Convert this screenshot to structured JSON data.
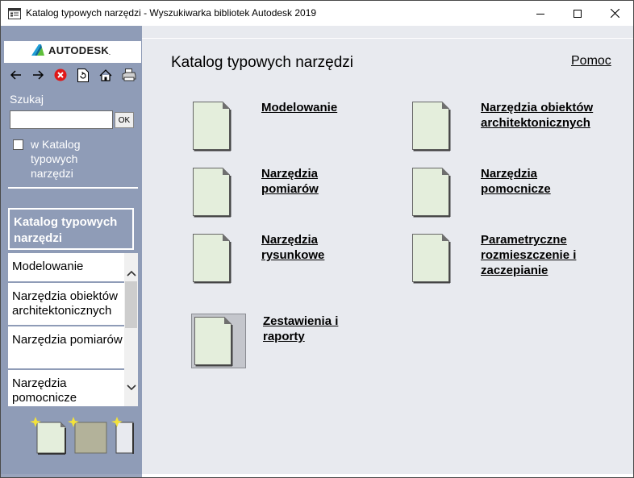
{
  "window": {
    "title": "Katalog typowych narzędzi - Wyszukiwarka bibliotek Autodesk 2019",
    "controls": {
      "minimize_icon": "minimize-icon",
      "maximize_icon": "maximize-icon",
      "close_icon": "close-icon"
    }
  },
  "sidebar": {
    "logo_text": "AUTODESK",
    "logo_tm": ".",
    "toolbar_icons": [
      "back-arrow-icon",
      "forward-arrow-icon",
      "stop-icon",
      "refresh-icon",
      "home-icon",
      "print-icon"
    ],
    "search": {
      "label": "Szukaj",
      "value": "",
      "ok_label": "OK"
    },
    "filter": {
      "checked": false,
      "label": "w Katalog typowych narzędzi"
    },
    "toc": {
      "header": "Katalog typowych narzędzi",
      "items": [
        "Modelowanie",
        "Narzędzia obiektów architektonicznych",
        "Narzędzia pomiarów",
        "Narzędzia pomocnicze"
      ]
    }
  },
  "main": {
    "title": "Katalog typowych narzędzi",
    "help_link": "Pomoc",
    "categories": [
      {
        "label_lines": [
          "Modelowanie"
        ]
      },
      {
        "label_lines": [
          "Narzędzia obiektów",
          "architektonicznych"
        ]
      },
      {
        "label_lines": [
          "Narzędzia",
          "pomiarów"
        ]
      },
      {
        "label_lines": [
          "Narzędzia",
          "pomocnicze"
        ]
      },
      {
        "label_lines": [
          "Narzędzia",
          "rysunkowe"
        ]
      },
      {
        "label_lines": [
          "Parametryczne",
          "rozmieszczenie i",
          "zaczepianie"
        ]
      },
      {
        "label_lines": [
          "Zestawienia i",
          "raporty"
        ]
      }
    ]
  },
  "colors": {
    "sidebar_bg": "#8f9cb7",
    "main_bg": "#e8eaef",
    "page_icon_fill": "#e4eedc",
    "page_icon_stroke": "#555555",
    "selected_tile_bg": "#c4c6cc"
  }
}
